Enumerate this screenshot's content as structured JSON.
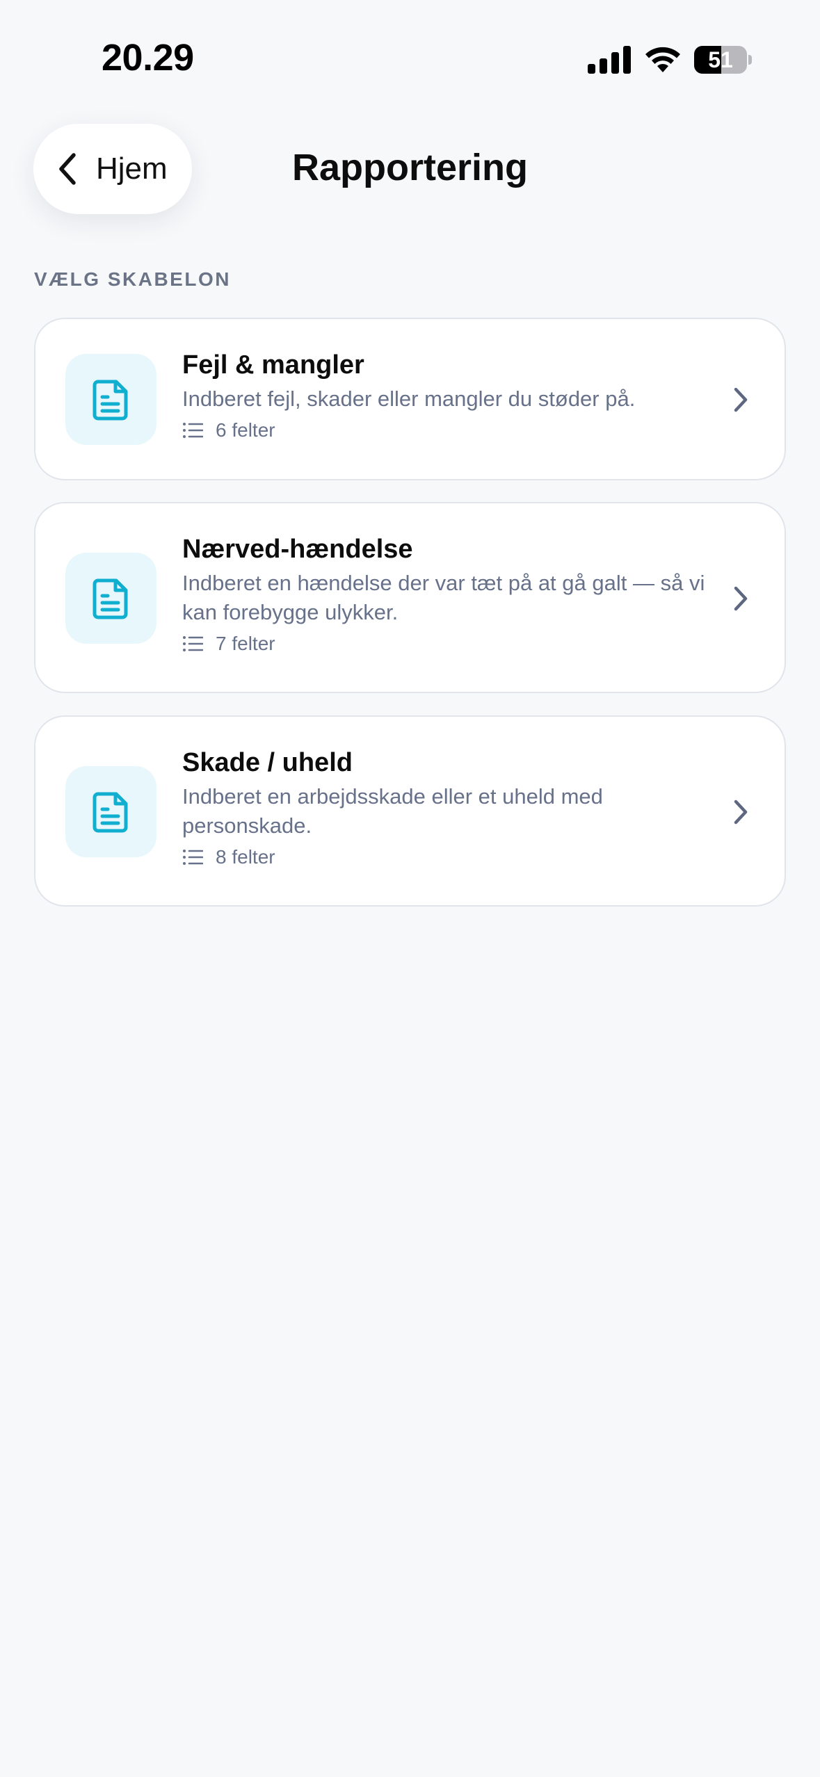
{
  "status_bar": {
    "time": "20.29",
    "battery_level": "51",
    "battery_fraction": 0.51
  },
  "nav": {
    "back_label": "Hjem",
    "title": "Rapportering"
  },
  "section": {
    "label": "VÆLG SKABELON"
  },
  "templates": [
    {
      "title": "Fejl & mangler",
      "description": "Indberet fejl, skader eller mangler du støder på.",
      "fields": "6 felter",
      "icon": "document-icon"
    },
    {
      "title": "Nærved-hændelse",
      "description": "Indberet en hændelse der var tæt på at gå galt — så vi kan forebygge ulykker.",
      "fields": "7 felter",
      "icon": "document-icon"
    },
    {
      "title": "Skade / uheld",
      "description": "Indberet en arbejdsskade eller et uheld med personskade.",
      "fields": "8 felter",
      "icon": "document-icon"
    }
  ],
  "colors": {
    "accent": "#10aecf",
    "accent_bg": "#e8f7fc",
    "background": "#f7f8fa",
    "muted_text": "#67718a"
  }
}
